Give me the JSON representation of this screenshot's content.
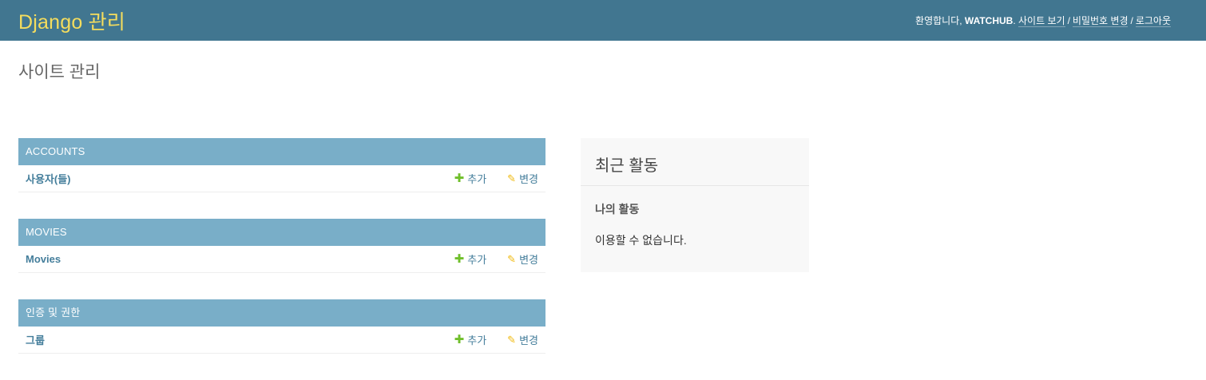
{
  "header": {
    "brand": "Django 관리",
    "welcome": "환영합니다, ",
    "username": "WATCHUB",
    "username_suffix": ". ",
    "view_site": "사이트 보기",
    "separator": "/",
    "change_password": "비밀번호 변경",
    "logout": "로그아웃"
  },
  "page": {
    "title": "사이트 관리"
  },
  "apps": [
    {
      "name": "ACCOUNTS",
      "models": [
        {
          "name": "사용자(들)",
          "add_label": "추가",
          "change_label": "변경"
        }
      ]
    },
    {
      "name": "MOVIES",
      "models": [
        {
          "name": "Movies",
          "add_label": "추가",
          "change_label": "변경"
        }
      ]
    },
    {
      "name": "인증 및 권한",
      "models": [
        {
          "name": "그룹",
          "add_label": "추가",
          "change_label": "변경"
        }
      ]
    }
  ],
  "sidebar": {
    "title": "최근 활동",
    "subtitle": "나의 활동",
    "empty_text": "이용할 수 없습니다."
  },
  "icons": {
    "add": "plus-icon",
    "change": "pencil-icon"
  },
  "colors": {
    "header_bg": "#417690",
    "brand": "#f5dd5d",
    "caption_bg": "#79aec8",
    "link": "#447e9b",
    "add_icon": "#70bf2b",
    "change_icon": "#efb80b",
    "sidebar_bg": "#f8f8f8"
  }
}
